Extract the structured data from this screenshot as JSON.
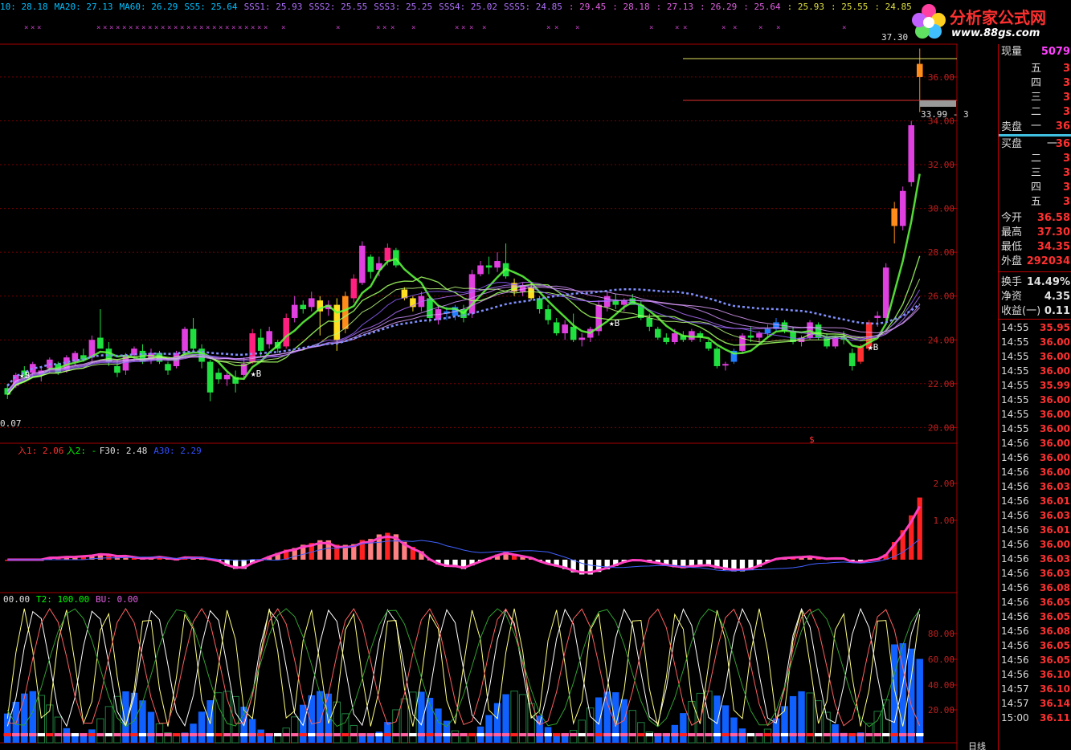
{
  "top_indicators": [
    {
      "text": "10: 28.18",
      "color": "#00c0ff"
    },
    {
      "text": "MA20: 27.13",
      "color": "#00c0ff"
    },
    {
      "text": "MA60: 26.29",
      "color": "#00c0ff"
    },
    {
      "text": "SS5: 25.64",
      "color": "#00c0ff"
    },
    {
      "text": "SSS1: 25.93",
      "color": "#b070ff"
    },
    {
      "text": "SSS2: 25.55",
      "color": "#b070ff"
    },
    {
      "text": "SSS3: 25.25",
      "color": "#b070ff"
    },
    {
      "text": "SSS4: 25.02",
      "color": "#b070ff"
    },
    {
      "text": "SSS5: 24.85",
      "color": "#b070ff"
    },
    {
      "text": ": 29.45",
      "color": "#e060e0"
    },
    {
      "text": ": 28.18",
      "color": "#e060e0"
    },
    {
      "text": ": 27.13",
      "color": "#e060e0"
    },
    {
      "text": ": 26.29",
      "color": "#e060e0"
    },
    {
      "text": ": 25.64",
      "color": "#e060e0"
    },
    {
      "text": ": 25.93",
      "color": "#e0e040"
    },
    {
      "text": ": 25.55",
      "color": "#e0e040"
    },
    {
      "text": ": 24.85",
      "color": "#e0e040"
    }
  ],
  "logo": {
    "title": "分析家公式网",
    "url": "www.88gs.com"
  },
  "price_axis": [
    "36.00",
    "34.00",
    "32.00",
    "30.00",
    "28.00",
    "26.00",
    "24.00",
    "22.00",
    "20.00"
  ],
  "price_labels": {
    "high": "37.30",
    "cursor": "33.99 - 3",
    "low": "0.07",
    "dollar": "$"
  },
  "buy_mark": "★B",
  "macd_legend": [
    {
      "text": "入1: 2.06",
      "color": "#ff3030"
    },
    {
      "text": "入2: -",
      "color": "#00ff00"
    },
    {
      "text": "F30: 2.48",
      "color": "#e0e0e0"
    },
    {
      "text": "A30: 2.29",
      "color": "#3050ff"
    }
  ],
  "macd_axis": [
    "2.00",
    "1.00"
  ],
  "kdj_legend": [
    {
      "text": "00.00",
      "color": "#e0e0e0"
    },
    {
      "text": "T2: 100.00",
      "color": "#00ff00"
    },
    {
      "text": "BU: 0.00",
      "color": "#e060e0"
    }
  ],
  "kdj_axis": [
    "80.00",
    "60.00",
    "40.00",
    "20.00"
  ],
  "period_label": "日线",
  "chart_data": {
    "type": "candlestick",
    "ylim": [
      19.5,
      37.5
    ],
    "ohlc": [
      [
        21.8,
        22.0,
        21.3,
        21.5
      ],
      [
        21.9,
        22.5,
        21.8,
        22.4
      ],
      [
        22.6,
        22.8,
        22.2,
        22.4
      ],
      [
        22.5,
        23.0,
        22.3,
        22.9
      ],
      [
        22.4,
        22.8,
        22.1,
        22.6
      ],
      [
        22.7,
        23.2,
        22.5,
        23.1
      ],
      [
        22.9,
        23.0,
        22.4,
        22.5
      ],
      [
        22.6,
        23.3,
        22.5,
        23.2
      ],
      [
        23.0,
        23.5,
        22.8,
        23.4
      ],
      [
        23.3,
        23.6,
        23.0,
        23.1
      ],
      [
        23.2,
        24.2,
        23.0,
        24.0
      ],
      [
        24.1,
        25.4,
        23.8,
        23.6
      ],
      [
        23.6,
        23.9,
        22.8,
        23.0
      ],
      [
        22.8,
        23.1,
        22.3,
        22.5
      ],
      [
        22.6,
        23.4,
        22.4,
        23.3
      ],
      [
        23.3,
        23.7,
        23.0,
        23.6
      ],
      [
        23.5,
        23.8,
        22.9,
        23.0
      ],
      [
        23.1,
        23.6,
        22.9,
        23.4
      ],
      [
        23.4,
        23.5,
        22.9,
        23.0
      ],
      [
        22.9,
        23.0,
        22.4,
        22.6
      ],
      [
        22.8,
        23.5,
        22.7,
        23.4
      ],
      [
        23.5,
        24.6,
        23.3,
        24.5
      ],
      [
        24.5,
        25.0,
        23.5,
        23.6
      ],
      [
        23.6,
        23.8,
        22.7,
        23.0
      ],
      [
        23.0,
        23.1,
        21.2,
        21.6
      ],
      [
        22.5,
        22.7,
        22.0,
        22.2
      ],
      [
        22.2,
        22.5,
        21.9,
        22.4
      ],
      [
        22.3,
        22.6,
        21.6,
        22.0
      ],
      [
        22.4,
        23.2,
        22.2,
        22.9
      ],
      [
        23.0,
        24.5,
        22.9,
        24.3
      ],
      [
        24.1,
        24.5,
        23.2,
        23.5
      ],
      [
        23.8,
        24.6,
        23.6,
        24.4
      ],
      [
        23.9,
        24.0,
        23.4,
        23.6
      ],
      [
        23.7,
        25.2,
        23.6,
        25.0
      ],
      [
        25.0,
        26.0,
        24.8,
        25.6
      ],
      [
        25.6,
        25.8,
        25.2,
        25.4
      ],
      [
        25.5,
        26.2,
        25.3,
        25.9
      ],
      [
        25.8,
        26.0,
        24.2,
        25.3
      ],
      [
        25.4,
        25.8,
        25.1,
        25.6
      ],
      [
        25.6,
        25.9,
        23.5,
        24.0
      ],
      [
        24.5,
        26.2,
        24.3,
        26.0
      ],
      [
        25.9,
        27.0,
        25.7,
        26.8
      ],
      [
        26.6,
        28.5,
        26.5,
        28.3
      ],
      [
        27.8,
        27.9,
        26.8,
        27.1
      ],
      [
        27.2,
        27.8,
        26.9,
        27.5
      ],
      [
        27.6,
        28.4,
        27.4,
        28.2
      ],
      [
        28.1,
        28.2,
        27.3,
        27.4
      ],
      [
        26.3,
        26.4,
        25.8,
        25.9
      ],
      [
        25.9,
        26.0,
        25.3,
        25.5
      ],
      [
        25.5,
        26.2,
        25.3,
        26.0
      ],
      [
        25.9,
        26.0,
        24.8,
        25.0
      ],
      [
        24.9,
        25.6,
        24.7,
        25.4
      ],
      [
        25.3,
        25.5,
        24.9,
        25.2
      ],
      [
        25.1,
        25.6,
        24.9,
        25.5
      ],
      [
        25.4,
        25.6,
        24.8,
        25.0
      ],
      [
        25.2,
        27.2,
        25.0,
        27.0
      ],
      [
        27.0,
        27.6,
        26.9,
        27.4
      ],
      [
        27.4,
        27.8,
        27.0,
        27.3
      ],
      [
        27.3,
        28.0,
        27.1,
        27.6
      ],
      [
        27.5,
        28.4,
        26.8,
        26.9
      ],
      [
        26.6,
        26.8,
        26.0,
        26.2
      ],
      [
        26.2,
        26.6,
        26.0,
        26.5
      ],
      [
        26.4,
        26.6,
        25.8,
        25.9
      ],
      [
        25.9,
        26.0,
        25.2,
        25.4
      ],
      [
        25.4,
        25.6,
        24.7,
        24.9
      ],
      [
        24.8,
        25.0,
        24.2,
        24.3
      ],
      [
        24.3,
        24.9,
        24.0,
        24.7
      ],
      [
        24.6,
        25.2,
        23.9,
        24.0
      ],
      [
        24.0,
        24.3,
        23.7,
        24.1
      ],
      [
        24.1,
        24.6,
        23.9,
        24.5
      ],
      [
        24.4,
        25.8,
        24.2,
        25.6
      ],
      [
        25.5,
        26.2,
        25.3,
        26.0
      ],
      [
        25.8,
        26.1,
        25.4,
        25.6
      ],
      [
        25.6,
        25.9,
        25.3,
        25.8
      ],
      [
        25.9,
        26.1,
        25.7,
        25.6
      ],
      [
        25.6,
        25.8,
        24.9,
        25.0
      ],
      [
        25.0,
        25.2,
        24.4,
        24.6
      ],
      [
        24.5,
        24.6,
        24.0,
        24.1
      ],
      [
        24.1,
        24.3,
        23.8,
        23.9
      ],
      [
        23.9,
        24.5,
        23.8,
        24.3
      ],
      [
        24.2,
        24.4,
        23.9,
        24.0
      ],
      [
        24.0,
        24.5,
        23.9,
        24.4
      ],
      [
        24.3,
        24.4,
        23.9,
        24.1
      ],
      [
        23.9,
        24.0,
        23.5,
        23.6
      ],
      [
        23.6,
        23.7,
        22.7,
        22.8
      ],
      [
        22.9,
        23.0,
        22.6,
        22.9
      ],
      [
        23.0,
        23.6,
        22.9,
        23.5
      ],
      [
        23.5,
        24.3,
        23.4,
        24.2
      ],
      [
        24.2,
        24.6,
        23.9,
        24.1
      ],
      [
        24.1,
        24.4,
        23.8,
        24.3
      ],
      [
        24.3,
        24.7,
        24.1,
        24.5
      ],
      [
        24.5,
        25.0,
        24.4,
        24.8
      ],
      [
        24.8,
        24.9,
        24.3,
        24.4
      ],
      [
        24.4,
        24.6,
        23.8,
        23.9
      ],
      [
        23.9,
        24.2,
        23.7,
        24.1
      ],
      [
        24.1,
        24.9,
        24.0,
        24.8
      ],
      [
        24.7,
        24.8,
        24.0,
        24.1
      ],
      [
        24.1,
        24.3,
        23.6,
        23.7
      ],
      [
        23.7,
        24.2,
        23.6,
        24.1
      ],
      [
        24.1,
        24.4,
        23.8,
        24.0
      ],
      [
        23.4,
        23.6,
        22.6,
        22.8
      ],
      [
        23.0,
        23.8,
        22.9,
        23.7
      ],
      [
        23.6,
        24.9,
        23.5,
        24.8
      ],
      [
        25.0,
        25.3,
        24.6,
        25.1
      ],
      [
        25.0,
        27.5,
        24.9,
        27.3
      ],
      [
        29.2,
        30.3,
        28.4,
        30.0
      ],
      [
        29.2,
        31.0,
        29.0,
        30.8
      ],
      [
        31.2,
        34.0,
        31.0,
        33.8
      ],
      [
        36.6,
        37.3,
        34.4,
        36.0
      ]
    ]
  },
  "panel": {
    "header": {
      "label": "现量",
      "value": "5079"
    },
    "sell": [
      {
        "label": "五",
        "value": "3"
      },
      {
        "label": "四",
        "value": "3"
      },
      {
        "label": "三",
        "value": "3"
      },
      {
        "label": "二",
        "value": "3"
      },
      {
        "label": "一",
        "value": "36"
      }
    ],
    "sell_title": "卖盘",
    "buy_title": "买盘",
    "buy": [
      {
        "label": "一",
        "value": "36"
      },
      {
        "label": "二",
        "value": "3"
      },
      {
        "label": "三",
        "value": "3"
      },
      {
        "label": "四",
        "value": "3"
      },
      {
        "label": "五",
        "value": "3"
      }
    ],
    "stats": [
      {
        "label": "今开",
        "value": "36.58",
        "color": "#ff3030"
      },
      {
        "label": "最高",
        "value": "37.30",
        "color": "#ff3030"
      },
      {
        "label": "最低",
        "value": "34.35",
        "color": "#ff3030"
      },
      {
        "label": "外盘",
        "value": "292034",
        "color": "#ff3030"
      },
      {
        "label": "换手",
        "value": "14.49%",
        "color": "#e0e0e0"
      },
      {
        "label": "净资",
        "value": "4.35",
        "color": "#e0e0e0"
      },
      {
        "label": "收益(一)",
        "value": "0.11",
        "color": "#e0e0e0"
      }
    ],
    "ticks": [
      {
        "t": "14:55",
        "p": "35.95"
      },
      {
        "t": "14:55",
        "p": "36.00"
      },
      {
        "t": "14:55",
        "p": "36.00"
      },
      {
        "t": "14:55",
        "p": "36.00"
      },
      {
        "t": "14:55",
        "p": "35.99"
      },
      {
        "t": "14:55",
        "p": "36.00"
      },
      {
        "t": "14:55",
        "p": "36.00"
      },
      {
        "t": "14:55",
        "p": "36.00"
      },
      {
        "t": "14:56",
        "p": "36.00"
      },
      {
        "t": "14:56",
        "p": "36.00"
      },
      {
        "t": "14:56",
        "p": "36.00"
      },
      {
        "t": "14:56",
        "p": "36.03"
      },
      {
        "t": "14:56",
        "p": "36.01"
      },
      {
        "t": "14:56",
        "p": "36.03"
      },
      {
        "t": "14:56",
        "p": "36.01"
      },
      {
        "t": "14:56",
        "p": "36.00"
      },
      {
        "t": "14:56",
        "p": "36.03"
      },
      {
        "t": "14:56",
        "p": "36.03"
      },
      {
        "t": "14:56",
        "p": "36.08"
      },
      {
        "t": "14:56",
        "p": "36.05"
      },
      {
        "t": "14:56",
        "p": "36.05"
      },
      {
        "t": "14:56",
        "p": "36.08"
      },
      {
        "t": "14:56",
        "p": "36.05"
      },
      {
        "t": "14:56",
        "p": "36.05"
      },
      {
        "t": "14:56",
        "p": "36.10"
      },
      {
        "t": "14:57",
        "p": "36.10"
      },
      {
        "t": "14:57",
        "p": "36.14"
      },
      {
        "t": "15:00",
        "p": "36.11"
      }
    ]
  }
}
